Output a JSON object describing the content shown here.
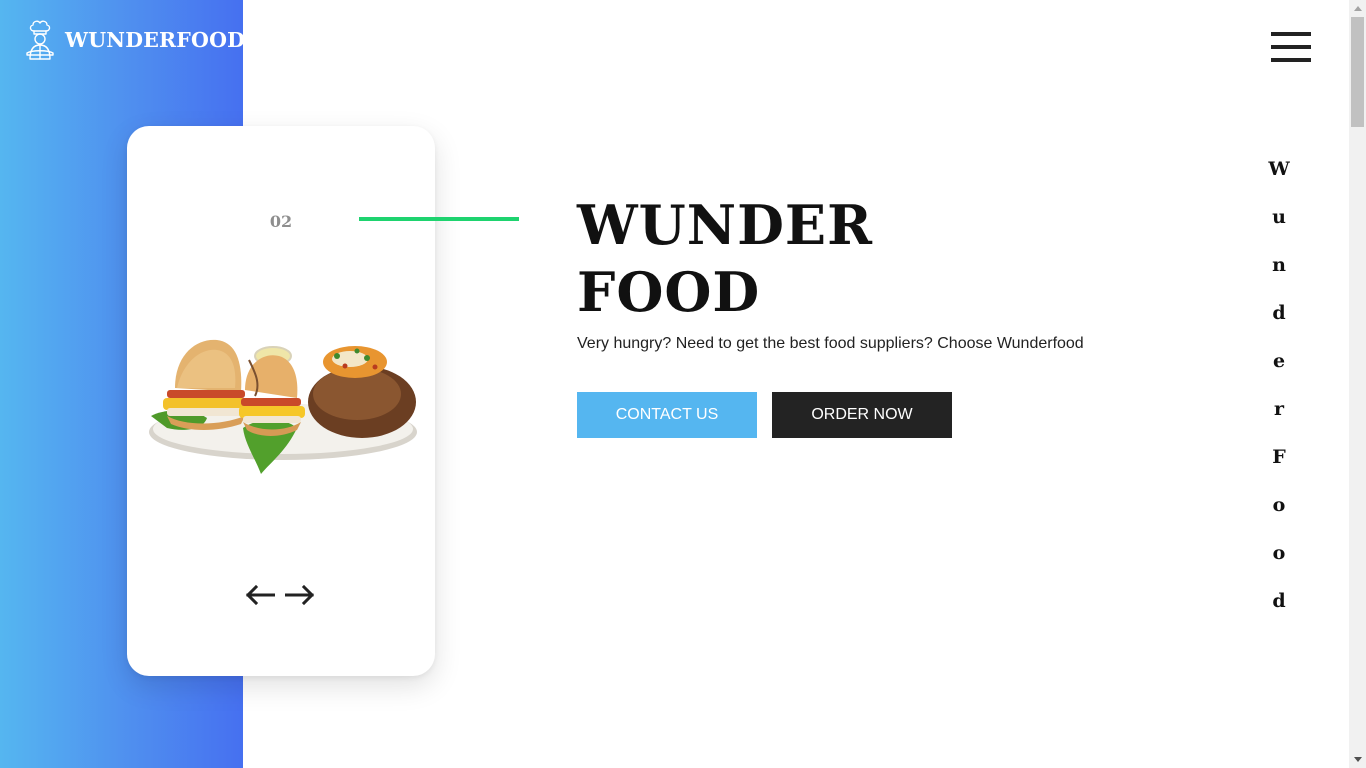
{
  "brand": {
    "name": "WUNDERFOOD",
    "logo_icon": "chef-icon"
  },
  "header": {
    "menu_icon": "hamburger-menu-icon"
  },
  "slider": {
    "current": "02",
    "image_alt": "sandwich-and-baked-potato-plate",
    "prev_icon": "arrow-left-icon",
    "next_icon": "arrow-right-icon"
  },
  "hero": {
    "title_line1": "WUNDER",
    "title_line2": "FOOD",
    "subtitle": "Very hungry? Need to get the best food suppliers? Choose Wunderfood",
    "contact_label": "CONTACT US",
    "order_label": "ORDER NOW"
  },
  "vertical_text": [
    "W",
    "u",
    "n",
    "d",
    "e",
    "r",
    "F",
    "o",
    "o",
    "d"
  ],
  "colors": {
    "accent_blue": "#55b6f0",
    "gradient_end": "#4670f0",
    "accent_green": "#1ed36f",
    "dark": "#232323"
  }
}
